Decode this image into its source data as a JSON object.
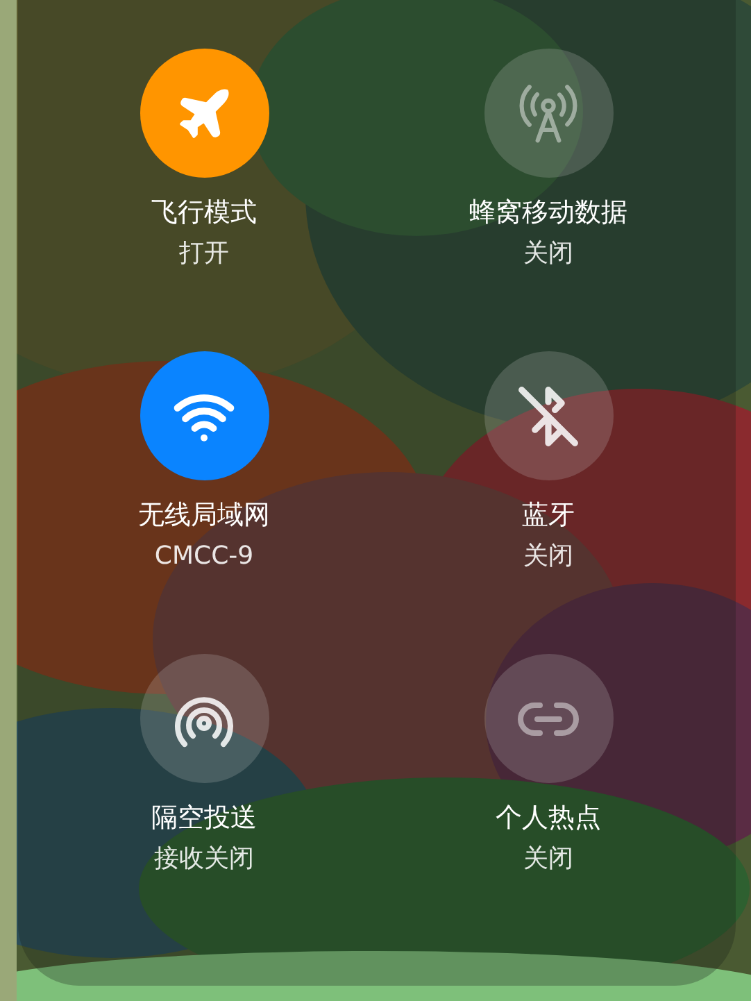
{
  "toggles": [
    {
      "kind": "airplane",
      "on": true,
      "label": "飞行模式",
      "status": "打开"
    },
    {
      "kind": "cellular",
      "on": false,
      "label": "蜂窝移动数据",
      "status": "关闭"
    },
    {
      "kind": "wifi",
      "on": true,
      "label": "无线局域网",
      "status": "CMCC-9"
    },
    {
      "kind": "bluetooth",
      "on": false,
      "label": "蓝牙",
      "status": "关闭"
    },
    {
      "kind": "airdrop",
      "on": false,
      "label": "隔空投送",
      "status": "接收关闭"
    },
    {
      "kind": "hotspot",
      "on": false,
      "label": "个人热点",
      "status": "关闭"
    }
  ]
}
